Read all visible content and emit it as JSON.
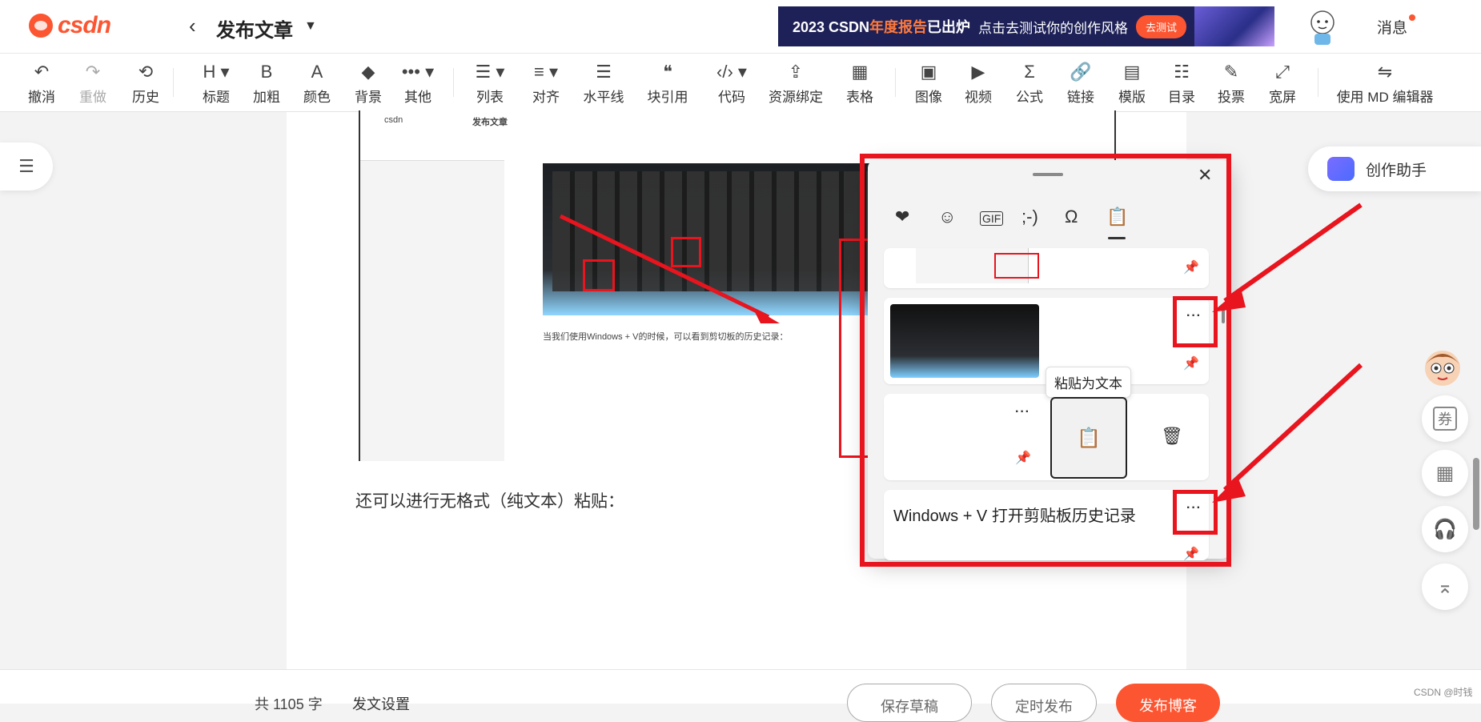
{
  "header": {
    "logo_text": "csdn",
    "back_icon": "chevron-left-icon",
    "title": "发布文章",
    "banner_title_prefix": "2023 CSDN",
    "banner_title_highlight": "年度报告",
    "banner_title_suffix": "已出炉",
    "banner_subtitle": "点击去测试你的创作风格",
    "banner_button": "去测试",
    "messages_label": "消息"
  },
  "toolbar": {
    "items": [
      {
        "label": "撤消",
        "icon": "undo-icon",
        "glyph": "↶"
      },
      {
        "label": "重做",
        "icon": "redo-icon",
        "glyph": "↷"
      },
      {
        "label": "历史",
        "icon": "history-icon",
        "glyph": "⟲"
      },
      {
        "label": "标题",
        "icon": "heading-icon",
        "glyph": "H ▾"
      },
      {
        "label": "加粗",
        "icon": "bold-icon",
        "glyph": "B"
      },
      {
        "label": "颜色",
        "icon": "font-color-icon",
        "glyph": "A"
      },
      {
        "label": "背景",
        "icon": "paint-bucket-icon",
        "glyph": "◆"
      },
      {
        "label": "其他",
        "icon": "more-icon",
        "glyph": "••• ▾"
      },
      {
        "label": "列表",
        "icon": "list-icon",
        "glyph": "☰ ▾"
      },
      {
        "label": "对齐",
        "icon": "align-icon",
        "glyph": "≡ ▾"
      },
      {
        "label": "水平线",
        "icon": "horizontal-rule-icon",
        "glyph": "☰"
      },
      {
        "label": "块引用",
        "icon": "quote-icon",
        "glyph": "❝"
      },
      {
        "label": "代码",
        "icon": "code-icon",
        "glyph": "‹/› ▾"
      },
      {
        "label": "资源绑定",
        "icon": "resource-icon",
        "glyph": "⇪"
      },
      {
        "label": "表格",
        "icon": "table-icon",
        "glyph": "▦"
      },
      {
        "label": "图像",
        "icon": "image-icon",
        "glyph": "▣"
      },
      {
        "label": "视频",
        "icon": "video-icon",
        "glyph": "▶"
      },
      {
        "label": "公式",
        "icon": "sigma-icon",
        "glyph": "Σ"
      },
      {
        "label": "链接",
        "icon": "link-icon",
        "glyph": "🔗"
      },
      {
        "label": "模版",
        "icon": "template-icon",
        "glyph": "▤"
      },
      {
        "label": "目录",
        "icon": "toc-icon",
        "glyph": "☷"
      },
      {
        "label": "投票",
        "icon": "vote-icon",
        "glyph": "✎"
      },
      {
        "label": "宽屏",
        "icon": "widescreen-icon",
        "glyph": "⤢"
      },
      {
        "label": "使用 MD 编辑器",
        "icon": "switch-editor-icon",
        "glyph": "⇋"
      }
    ]
  },
  "editor": {
    "paragraph": "还可以进行无格式（纯文本）粘贴：",
    "embedded_caption": "当我们使用Windows + V的时候，可以看到剪切板的历史记录：",
    "embedded_title": "发布文章",
    "embedded_logo": "csdn"
  },
  "clipboard_panel": {
    "tabs": [
      "favorites-icon",
      "emoji-icon",
      "gif-icon",
      "kaomoji-icon",
      "symbols-icon",
      "clipboard-icon"
    ],
    "tab_glyphs": [
      "❤",
      "☺",
      "GIF",
      ";-)",
      "Ω",
      "📋"
    ],
    "more_label": "···",
    "tooltip": "粘贴为文本",
    "text_item": "Windows + V  打开剪贴板历史记录"
  },
  "side": {
    "assistant_label": "创作助手",
    "coupon_label": "券"
  },
  "bottom": {
    "word_count": "共 1105 字",
    "settings": "发文设置",
    "save_draft": "保存草稿",
    "schedule": "定时发布",
    "publish": "发布博客"
  },
  "watermark": "CSDN @时钱",
  "colors": {
    "brand": "#fc5531",
    "annotation_red": "#e8141e"
  }
}
